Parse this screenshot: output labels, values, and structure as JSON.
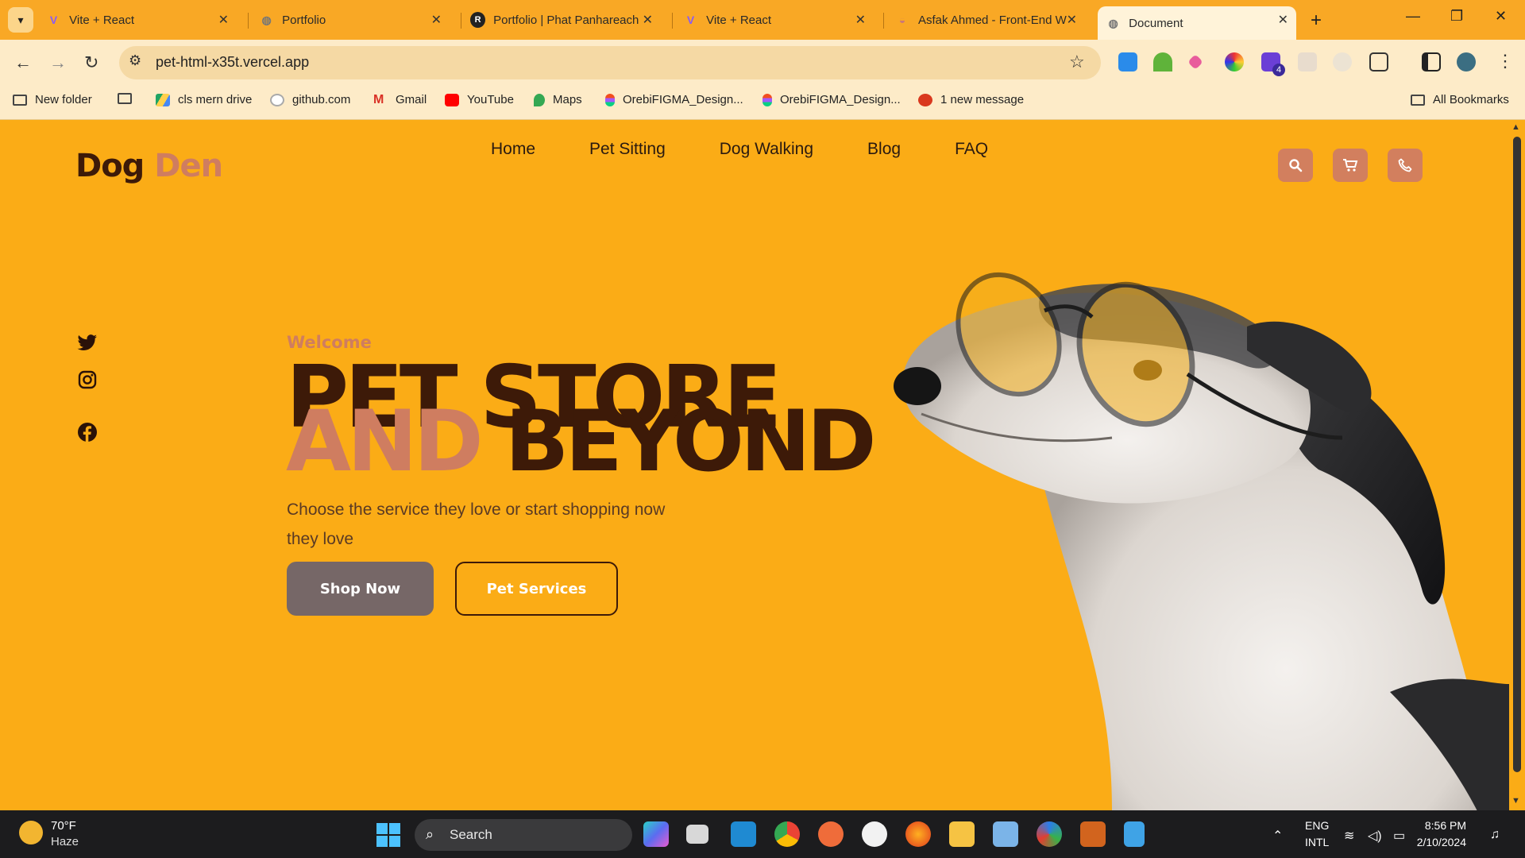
{
  "browser": {
    "tabs": [
      {
        "title": "Vite + React",
        "active": false
      },
      {
        "title": "Portfolio",
        "active": false
      },
      {
        "title": "Portfolio | Phat Panhareach",
        "active": false
      },
      {
        "title": "Vite + React",
        "active": false
      },
      {
        "title": "Asfak Ahmed - Front-End W",
        "active": false
      },
      {
        "title": "Document",
        "active": true
      }
    ],
    "url": "pet-html-x35t.vercel.app",
    "extension_badge": "4",
    "bookmarks": [
      {
        "label": "New folder",
        "icon": "folder-icon"
      },
      {
        "label": "",
        "icon": "folder-icon"
      },
      {
        "label": "cls mern drive",
        "icon": "google-drive-icon"
      },
      {
        "label": "github.com",
        "icon": "github-icon"
      },
      {
        "label": "Gmail",
        "icon": "gmail-icon"
      },
      {
        "label": "YouTube",
        "icon": "youtube-icon"
      },
      {
        "label": "Maps",
        "icon": "maps-icon"
      },
      {
        "label": "OrebiFIGMA_Design...",
        "icon": "figma-icon"
      },
      {
        "label": "OrebiFIGMA_Design...",
        "icon": "figma-icon"
      },
      {
        "label": "1 new message",
        "icon": "message-icon"
      }
    ],
    "all_bookmarks": "All Bookmarks"
  },
  "site": {
    "logo_part1": "Dog",
    "logo_part2": "Den",
    "nav": [
      "Home",
      "Pet Sitting",
      "Dog Walking",
      "Blog",
      "FAQ"
    ],
    "header_icons": [
      "search-icon",
      "cart-icon",
      "phone-icon"
    ],
    "social": [
      "twitter-icon",
      "instagram-icon",
      "facebook-icon"
    ],
    "hero": {
      "welcome": "Welcome",
      "line1": "PET STORE",
      "line2_accent": "AND",
      "line2_rest": "BEYOND",
      "subtext": "Choose the service they love or start shopping now they love",
      "primary_button": "Shop Now",
      "secondary_button": "Pet Services"
    },
    "colors": {
      "background": "#fbac16",
      "brand_dark": "#3d1a08",
      "brand_accent": "#cf7d60",
      "button_gray": "#766767"
    }
  },
  "taskbar": {
    "temperature": "70°F",
    "condition": "Haze",
    "search_label": "Search",
    "language": "ENG",
    "layout": "INTL",
    "time": "8:56 PM",
    "date": "2/10/2024"
  }
}
